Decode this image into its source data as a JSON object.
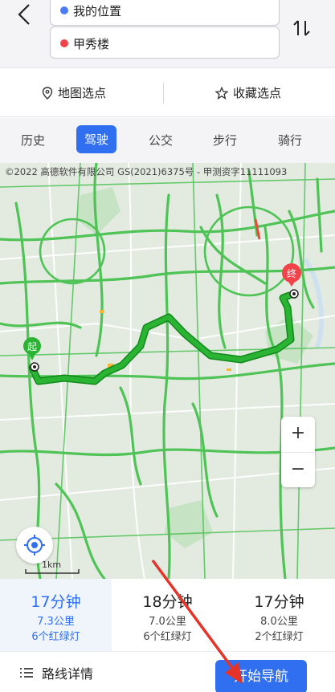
{
  "header": {
    "start_point": "我的位置",
    "end_point": "甲秀楼"
  },
  "pick_bar": {
    "map_pick": "地图选点",
    "fav_pick": "收藏选点"
  },
  "mode_tabs": [
    {
      "label": "历史"
    },
    {
      "label": "驾驶"
    },
    {
      "label": "公交"
    },
    {
      "label": "步行"
    },
    {
      "label": "骑行"
    }
  ],
  "map": {
    "copyright": "©2022 高德软件有限公司 GS(2021)6375号 - 甲测资字11111093",
    "start_marker": "起",
    "end_marker": "终",
    "zoom_in": "+",
    "zoom_out": "−",
    "scale_label": "1km"
  },
  "routes": [
    {
      "time": "17分钟",
      "distance": "7.3公里",
      "lights": "6个红绿灯"
    },
    {
      "time": "18分钟",
      "distance": "7.0公里",
      "lights": "6个红绿灯"
    },
    {
      "time": "17分钟",
      "distance": "8.0公里",
      "lights": "2个红绿灯"
    }
  ],
  "bottom": {
    "details_label": "路线详情",
    "start_nav_label": "开始导航"
  },
  "colors": {
    "accent": "#2f6ff0",
    "route_green": "#19a51b",
    "road_green": "#49c34f",
    "annotation_red": "#e5332a"
  }
}
